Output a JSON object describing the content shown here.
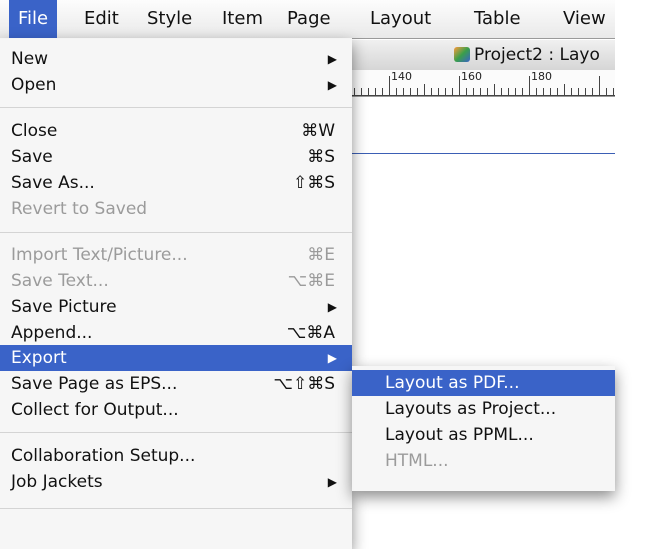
{
  "menubar": {
    "items": [
      "File",
      "Edit",
      "Style",
      "Item",
      "Page",
      "Layout",
      "Table",
      "View"
    ]
  },
  "document": {
    "title": "Project2 : Layo",
    "ruler_labels": [
      "140",
      "160",
      "180"
    ]
  },
  "file_menu": {
    "new": "New",
    "open": "Open",
    "close": "Close",
    "close_shortcut": "⌘W",
    "save": "Save",
    "save_shortcut": "⌘S",
    "save_as": "Save As...",
    "save_as_shortcut": "⇧⌘S",
    "revert": "Revert to Saved",
    "import": "Import Text/Picture...",
    "import_shortcut": "⌘E",
    "save_text": "Save Text...",
    "save_text_shortcut": "⌥⌘E",
    "save_picture": "Save Picture",
    "append": "Append...",
    "append_shortcut": "⌥⌘A",
    "export": "Export",
    "save_eps": "Save Page as EPS...",
    "save_eps_shortcut": "⌥⇧⌘S",
    "collect": "Collect for Output...",
    "collab": "Collaboration Setup...",
    "jackets": "Job Jackets",
    "submenu_arrow": "▶"
  },
  "export_menu": {
    "pdf": "Layout as PDF...",
    "project": "Layouts as Project...",
    "ppml": "Layout as PPML...",
    "html": "HTML..."
  },
  "colors": {
    "highlight": "#3a63c8"
  }
}
